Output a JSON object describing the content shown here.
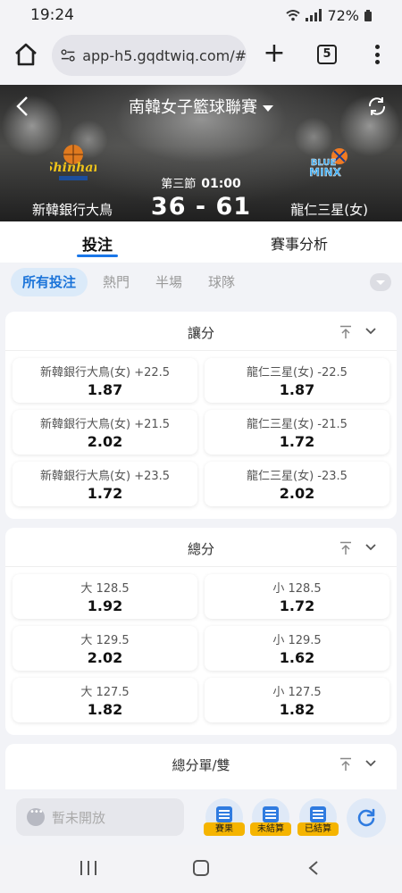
{
  "status_bar": {
    "time": "19:24",
    "battery": "72%"
  },
  "browser": {
    "url": "app-h5.gqdtwiq.com/#",
    "tab_count": "5"
  },
  "match": {
    "league": "南韓女子籃球聯賽",
    "period_label": "第三節",
    "clock": "01:00",
    "home_team": "新韓銀行大鳥",
    "away_team": "龍仁三星(女)",
    "score": "36 - 61",
    "home_logo_text": "Shinhan",
    "away_logo_text": "BLUE MINX"
  },
  "main_tabs": [
    "投注",
    "賽事分析"
  ],
  "filters": [
    "所有投注",
    "熱門",
    "半場",
    "球隊"
  ],
  "markets": [
    {
      "title": "讓分",
      "rows": [
        [
          {
            "label": "新韓銀行大鳥(女) +22.5",
            "odds": "1.87"
          },
          {
            "label": "龍仁三星(女) -22.5",
            "odds": "1.87"
          }
        ],
        [
          {
            "label": "新韓銀行大鳥(女) +21.5",
            "odds": "2.02"
          },
          {
            "label": "龍仁三星(女) -21.5",
            "odds": "1.72"
          }
        ],
        [
          {
            "label": "新韓銀行大鳥(女) +23.5",
            "odds": "1.72"
          },
          {
            "label": "龍仁三星(女) -23.5",
            "odds": "2.02"
          }
        ]
      ]
    },
    {
      "title": "總分",
      "rows": [
        [
          {
            "label": "大 128.5",
            "odds": "1.92"
          },
          {
            "label": "小 128.5",
            "odds": "1.72"
          }
        ],
        [
          {
            "label": "大 129.5",
            "odds": "2.02"
          },
          {
            "label": "小 129.5",
            "odds": "1.62"
          }
        ],
        [
          {
            "label": "大 127.5",
            "odds": "1.82"
          },
          {
            "label": "小 127.5",
            "odds": "1.82"
          }
        ]
      ]
    },
    {
      "title": "總分單/雙",
      "rows": []
    }
  ],
  "bottom_bar": {
    "chat_placeholder": "暫未開放",
    "tools": [
      "賽果",
      "未結算",
      "已結算"
    ]
  },
  "colors": {
    "accent": "#1976e8",
    "tag": "#f5b400",
    "chip_bg": "#dbeaf9"
  }
}
